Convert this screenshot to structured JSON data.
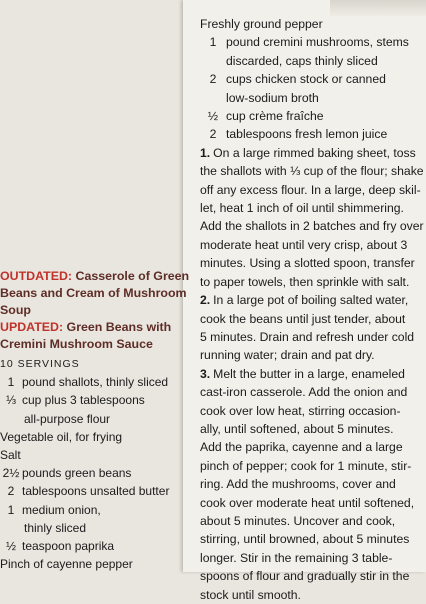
{
  "right": {
    "ingredients": [
      {
        "qty": "",
        "text": "Freshly ground pepper",
        "cont": []
      },
      {
        "qty": "1",
        "text": "pound cremini mushrooms, stems",
        "cont": [
          "discarded, caps thinly sliced"
        ]
      },
      {
        "qty": "2",
        "text": "cups chicken stock or canned",
        "cont": [
          "low-sodium broth"
        ]
      },
      {
        "qty": "½",
        "text": "cup crème fraîche",
        "cont": []
      },
      {
        "qty": "2",
        "text": "tablespoons fresh lemon juice",
        "cont": []
      }
    ],
    "steps": [
      {
        "num": "1.",
        "lines": [
          "On a large rimmed baking sheet, toss",
          "the shallots with ⅓ cup of the flour; shake",
          "off any excess flour. In a large, deep skil-",
          "let, heat 1 inch of oil until shimmering.",
          "Add the shallots in 2 batches and fry over",
          "moderate heat until very crisp, about 3",
          "minutes. Using a slotted spoon, transfer",
          "to paper towels, then sprinkle with salt."
        ]
      },
      {
        "num": "2.",
        "lines": [
          "In a large pot of boiling salted water,",
          "cook the beans until just tender, about",
          "5 minutes. Drain and refresh under cold",
          "running water; drain and pat dry."
        ]
      },
      {
        "num": "3.",
        "lines": [
          "Melt the butter in a large, enameled",
          "cast-iron casserole. Add the onion and",
          "cook over low heat, stirring occasion-",
          "ally, until softened, about 5 minutes.",
          "Add the paprika, cayenne and a large",
          "pinch of pepper; cook for 1 minute, stir-",
          "ring. Add the mushrooms, cover and",
          "cook over moderate heat until softened,",
          "about 5 minutes. Uncover and cook,",
          "stirring, until browned, about 5 minutes",
          "longer. Stir in the remaining 3 table-",
          "spoons of flour and gradually stir in the",
          "stock until smooth."
        ]
      }
    ]
  },
  "left": {
    "outdated_label": "OUTDATED:",
    "outdated_lines": [
      " Casserole of Green",
      "Beans and Cream of Mushroom",
      "Soup"
    ],
    "updated_label": "UPDATED:",
    "updated_lines": [
      " Green Beans with",
      "Cremini Mushroom Sauce"
    ],
    "servings": "10 SERVINGS",
    "ingredients": [
      {
        "qty": "1",
        "text": "pound shallots, thinly sliced",
        "cont": []
      },
      {
        "qty": "⅓",
        "text": "cup plus 3 tablespoons",
        "cont": [
          "all-purpose flour"
        ]
      },
      {
        "qty": "",
        "text": "Vegetable oil, for frying",
        "cont": []
      },
      {
        "qty": "",
        "text": "Salt",
        "cont": []
      },
      {
        "qty": "2½",
        "text": "pounds green beans",
        "cont": []
      },
      {
        "qty": "2",
        "text": "tablespoons unsalted butter",
        "cont": []
      },
      {
        "qty": "1",
        "text": "medium onion,",
        "cont": [
          "thinly sliced"
        ]
      },
      {
        "qty": "½",
        "text": "teaspoon paprika",
        "cont": []
      },
      {
        "qty": "",
        "text": "Pinch of cayenne pepper",
        "cont": []
      }
    ]
  }
}
